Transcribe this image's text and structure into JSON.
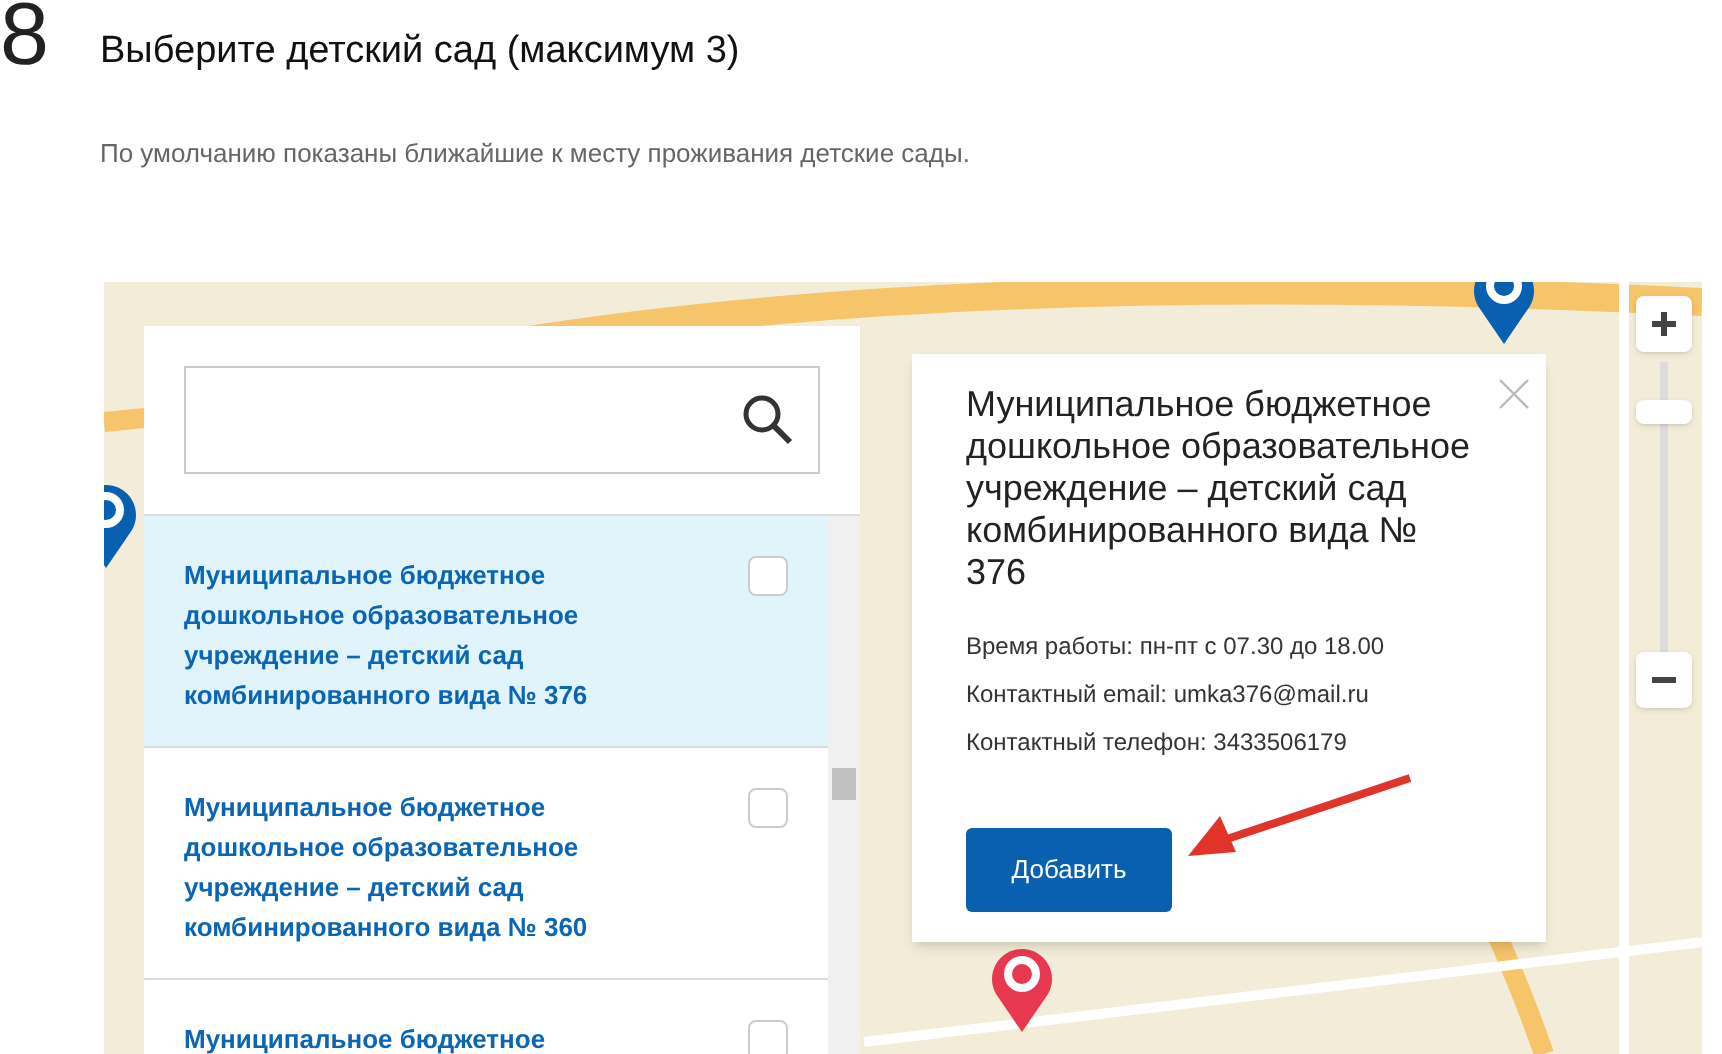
{
  "step": {
    "number": "8",
    "title": "Выберите детский сад (максимум 3)",
    "hint": "По умолчанию показаны ближайшие к месту проживания детские сады."
  },
  "list": {
    "items": [
      {
        "name": "Муниципальное бюджетное дошкольное образовательное учреждение – детский сад комбинированного вида № 376",
        "selected": true,
        "checked": false
      },
      {
        "name": "Муниципальное бюджетное дошкольное образовательное учреждение – детский сад комбинированного вида № 360",
        "selected": false,
        "checked": false
      },
      {
        "name": "Муниципальное бюджетное",
        "selected": false,
        "checked": false
      }
    ]
  },
  "popup": {
    "title": "Муниципальное бюджетное дошкольное образовательное учреждение – детский сад комбинированного вида № 376",
    "details": [
      "Время работы: пн-пт с 07.30 до 18.00",
      "Контактный email: umka376@mail.ru",
      "Контактный телефон: 3433506179"
    ],
    "button": "Добавить"
  },
  "pins": [
    {
      "kind": "blue"
    },
    {
      "kind": "blue"
    },
    {
      "kind": "red"
    }
  ]
}
